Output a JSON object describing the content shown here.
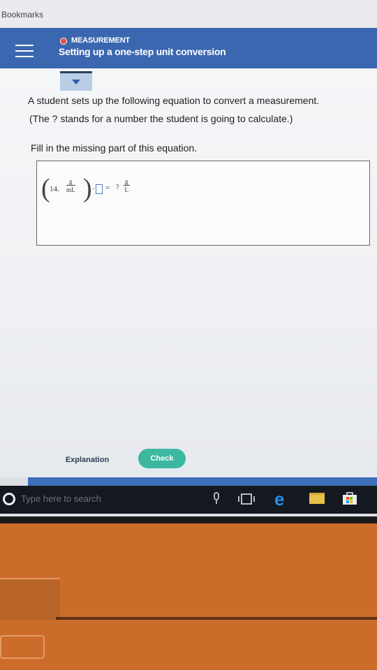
{
  "browser": {
    "bookmarks_label": "Bookmarks"
  },
  "header": {
    "topic": "MEASUREMENT",
    "title": "Setting up a one-step unit conversion",
    "topic_dot_color": "#e84a3c",
    "bar_color": "#3b67b0"
  },
  "question": {
    "line1": "A student sets up the following equation to convert a measurement.",
    "line2": "(The ? stands for a number the student is going to calculate.)",
    "line3": "Fill in the missing part of this equation."
  },
  "equation": {
    "open_paren": "(",
    "close_paren": ")",
    "value": "14.",
    "numerator_unit": "g",
    "denominator_unit": "mL",
    "multiply": "·",
    "equals": "=",
    "unknown": "?",
    "result_numerator_unit": "g",
    "result_denominator_unit": "L"
  },
  "actions": {
    "explanation_label": "Explanation",
    "check_label": "Check",
    "check_color": "#3cb8a0"
  },
  "taskbar": {
    "search_placeholder": "Type here to search",
    "icons": [
      "cortana-icon",
      "microphone-icon",
      "task-view-icon",
      "edge-icon",
      "file-explorer-icon",
      "store-icon"
    ]
  }
}
